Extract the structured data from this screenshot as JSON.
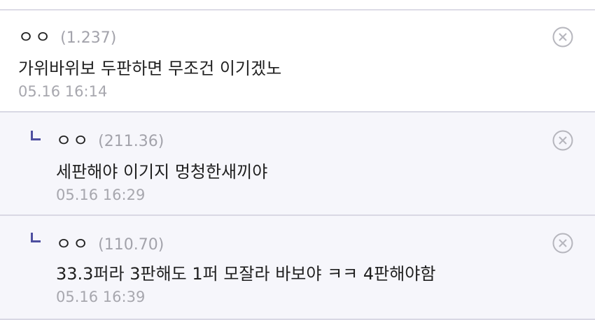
{
  "colors": {
    "reply_icon": "#4e4fa0",
    "reply_bg": "#f6f6fb",
    "divider": "#d9d8e4",
    "meta_text": "#a7a7ae"
  },
  "comments": [
    {
      "nickname": "ㅇㅇ",
      "ip": "(1.237)",
      "content": "가위바위보 두판하면 무조건 이기겠노",
      "date": "05.16 16:14",
      "is_reply": false,
      "delete_icon": "close-circle-icon"
    },
    {
      "nickname": "ㅇㅇ",
      "ip": "(211.36)",
      "content": "세판해야 이기지 멍청한새끼야",
      "date": "05.16 16:29",
      "is_reply": true,
      "reply_icon": "reply-arrow-icon",
      "delete_icon": "close-circle-icon"
    },
    {
      "nickname": "ㅇㅇ",
      "ip": "(110.70)",
      "content": "33.3퍼라 3판해도 1퍼 모잘라 바보야 ㅋㅋ 4판해야함",
      "date": "05.16 16:39",
      "is_reply": true,
      "reply_icon": "reply-arrow-icon",
      "delete_icon": "close-circle-icon"
    }
  ]
}
